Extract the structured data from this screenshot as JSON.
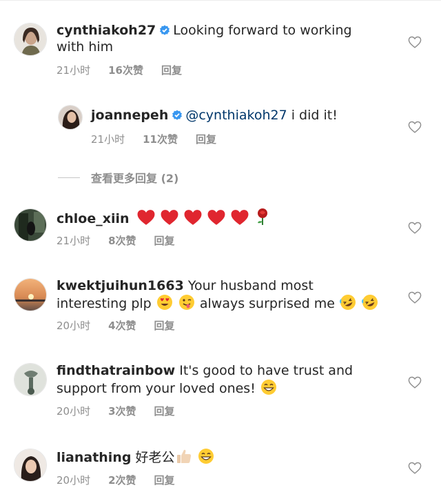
{
  "colors": {
    "text": "#262626",
    "meta": "#8e8e8e",
    "verified": "#3897f0",
    "mention": "#00376b",
    "heart_emoji": "#e0262f"
  },
  "comments": [
    {
      "username": "cynthiakoh27",
      "verified": true,
      "text": "Looking forward to working with him",
      "time": "21小时",
      "likes": "16次赞",
      "reply": "回复"
    },
    {
      "username": "joannepeh",
      "verified": true,
      "mention": "@cynthiakoh27",
      "text": " i did it!",
      "time": "21小时",
      "likes": "11次赞",
      "reply": "回复"
    },
    {
      "username": "chloe_xiin",
      "text": "",
      "emojis": [
        "red-heart",
        "red-heart",
        "red-heart",
        "red-heart",
        "red-heart",
        "rose"
      ],
      "time": "21小时",
      "likes": "8次赞",
      "reply": "回复"
    },
    {
      "username": "kwektjuihun1663",
      "text": "Your husband most interesting plp",
      "text2": "always surprised me",
      "emojis": [
        "heart-eyes-face",
        "winking-tongue-face",
        "rofl-face",
        "rofl-face"
      ],
      "time": "20小时",
      "likes": "4次赞",
      "reply": "回复"
    },
    {
      "username": "findthatrainbow",
      "text": "It's good to have trust and support from your loved ones!",
      "emojis": [
        "grinning-face"
      ],
      "time": "20小时",
      "likes": "3次赞",
      "reply": "回复"
    },
    {
      "username": "lianathing",
      "text": "好老公",
      "emojis": [
        "thumbs-up",
        "grinning-face"
      ],
      "time": "20小时",
      "likes": "2次赞",
      "reply": "回复"
    }
  ],
  "view_more_replies": "查看更多回复 (2)"
}
